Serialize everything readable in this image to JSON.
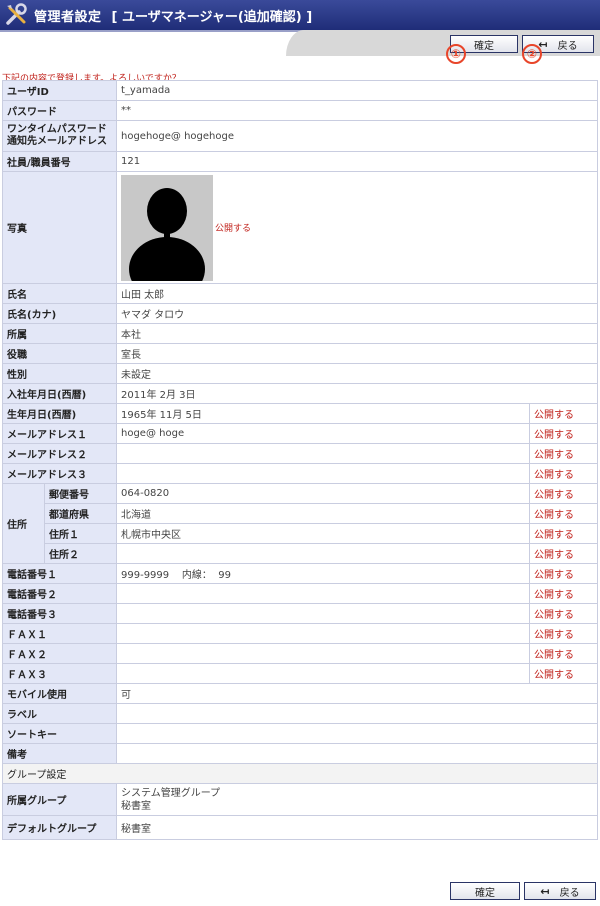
{
  "header": {
    "title": "管理者設定",
    "subtitle": "[ ユーザマネージャー(追加確認) ]"
  },
  "toolbar": {
    "confirm_label": "確定",
    "back_label": "戻る",
    "callout_1": "①",
    "callout_2": "②"
  },
  "notice": "下記の内容で登録します。よろしいですか？",
  "public_label": "公開する",
  "fields": {
    "user_id": {
      "label": "ユーザID",
      "value": "t_yamada"
    },
    "password": {
      "label": "パスワード",
      "value": "**"
    },
    "otp_mail": {
      "label": "ワンタイムパスワード\n通知先メールアドレス",
      "value": "hogehoge@ hogehoge"
    },
    "employee_no": {
      "label": "社員/職員番号",
      "value": "121"
    },
    "photo": {
      "label": "写真"
    },
    "name": {
      "label": "氏名",
      "value": "山田  太郎"
    },
    "name_kana": {
      "label": "氏名(カナ)",
      "value": "ヤマダ  タロウ"
    },
    "dept": {
      "label": "所属",
      "value": "本社"
    },
    "position": {
      "label": "役職",
      "value": "室長"
    },
    "gender": {
      "label": "性別",
      "value": "未設定"
    },
    "join_date": {
      "label": "入社年月日(西暦)",
      "value": "2011年  2月  3日"
    },
    "birth_date": {
      "label": "生年月日(西暦)",
      "value": "1965年  11月  5日"
    },
    "mail1": {
      "label": "メールアドレス１",
      "value": "hoge@ hoge"
    },
    "mail2": {
      "label": "メールアドレス２",
      "value": ""
    },
    "mail3": {
      "label": "メールアドレス３",
      "value": ""
    },
    "address_group": {
      "label": "住所"
    },
    "zip": {
      "label": "郵便番号",
      "value": "064-0820"
    },
    "pref": {
      "label": "都道府県",
      "value": "北海道"
    },
    "addr1": {
      "label": "住所１",
      "value": "札幌市中央区"
    },
    "addr2": {
      "label": "住所２",
      "value": ""
    },
    "tel1": {
      "label": "電話番号１",
      "value": "999-9999    内線：  99"
    },
    "tel2": {
      "label": "電話番号２",
      "value": ""
    },
    "tel3": {
      "label": "電話番号３",
      "value": ""
    },
    "fax1": {
      "label": "ＦＡＸ１",
      "value": ""
    },
    "fax2": {
      "label": "ＦＡＸ２",
      "value": ""
    },
    "fax3": {
      "label": "ＦＡＸ３",
      "value": ""
    },
    "mobile": {
      "label": "モバイル使用",
      "value": "可"
    },
    "label": {
      "label": "ラベル",
      "value": ""
    },
    "sortkey": {
      "label": "ソートキー",
      "value": ""
    },
    "memo": {
      "label": "備考",
      "value": ""
    }
  },
  "group_settings": {
    "section_title": "グループ設定",
    "groups": {
      "label": "所属グループ",
      "value_1": "システム管理グループ",
      "value_2": "秘書室"
    },
    "default_group": {
      "label": "デフォルトグループ",
      "value": "秘書室"
    }
  },
  "icons": {
    "title": "tools-icon",
    "back": "back-arrow-icon",
    "avatar": "person-silhouette-icon"
  },
  "colors": {
    "title_bar": "#1f2d78",
    "label_bg": "#e3e7f7",
    "public_text": "#c0201a",
    "callout": "#e8452a"
  }
}
